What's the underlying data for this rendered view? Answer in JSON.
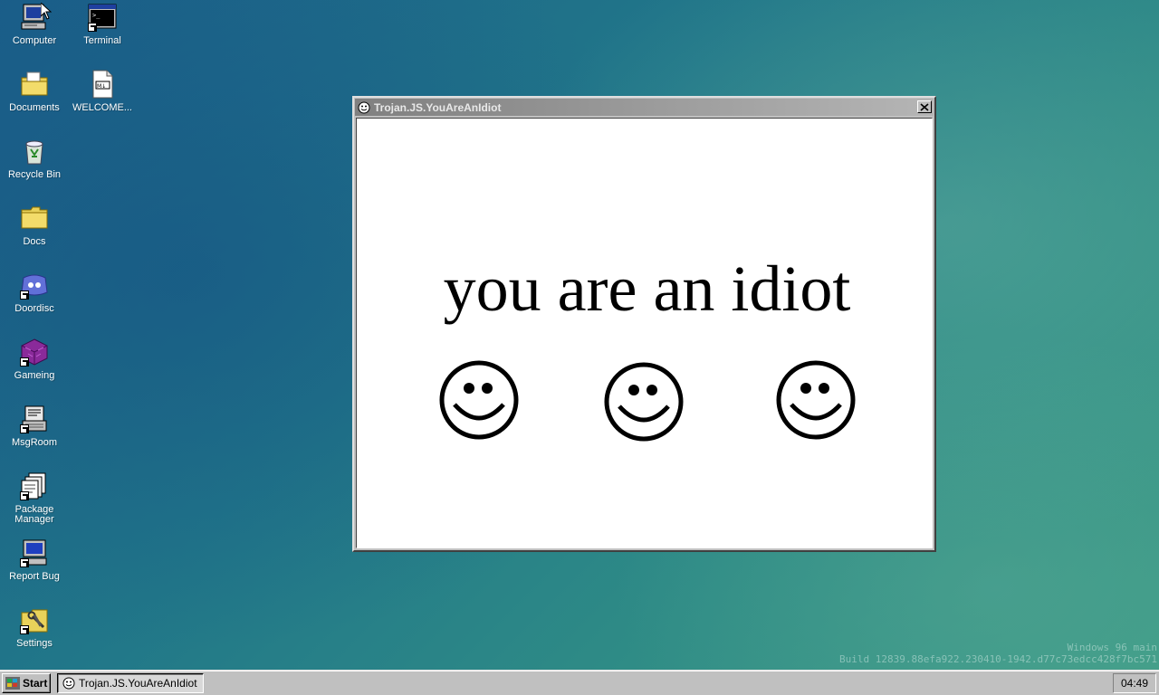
{
  "desktop": {
    "icons": [
      {
        "label": "Computer",
        "icon": "computer-icon"
      },
      {
        "label": "Terminal",
        "icon": "terminal-icon"
      },
      {
        "label": "Documents",
        "icon": "documents-folder-icon"
      },
      {
        "label": "WELCOME...",
        "icon": "markdown-file-icon"
      },
      {
        "label": "Recycle Bin",
        "icon": "recycle-bin-icon"
      },
      {
        "label": "Docs",
        "icon": "folder-icon"
      },
      {
        "label": "Doordisc",
        "icon": "doordisc-icon"
      },
      {
        "label": "Gameing",
        "icon": "gameing-cube-icon"
      },
      {
        "label": "MsgRoom",
        "icon": "msgroom-icon"
      },
      {
        "label": "Package Manager",
        "icon": "package-manager-icon"
      },
      {
        "label": "Report Bug",
        "icon": "report-bug-icon"
      },
      {
        "label": "Settings",
        "icon": "settings-icon"
      }
    ]
  },
  "window": {
    "title": "Trojan.JS.YouAreAnIdiot",
    "headline": "you are an idiot",
    "smiley_count": 3
  },
  "watermark": {
    "line1": "Windows 96 main",
    "line2": "Build 12839.88efa922.230410-1942.d77c73edcc428f7bc571"
  },
  "taskbar": {
    "start_label": "Start",
    "task_label": "Trojan.JS.YouAreAnIdiot",
    "clock": "04:49"
  },
  "colors": {
    "desktop_teal": "#217789",
    "window_gray": "#c0c0c0",
    "title_gray": "#808080"
  }
}
